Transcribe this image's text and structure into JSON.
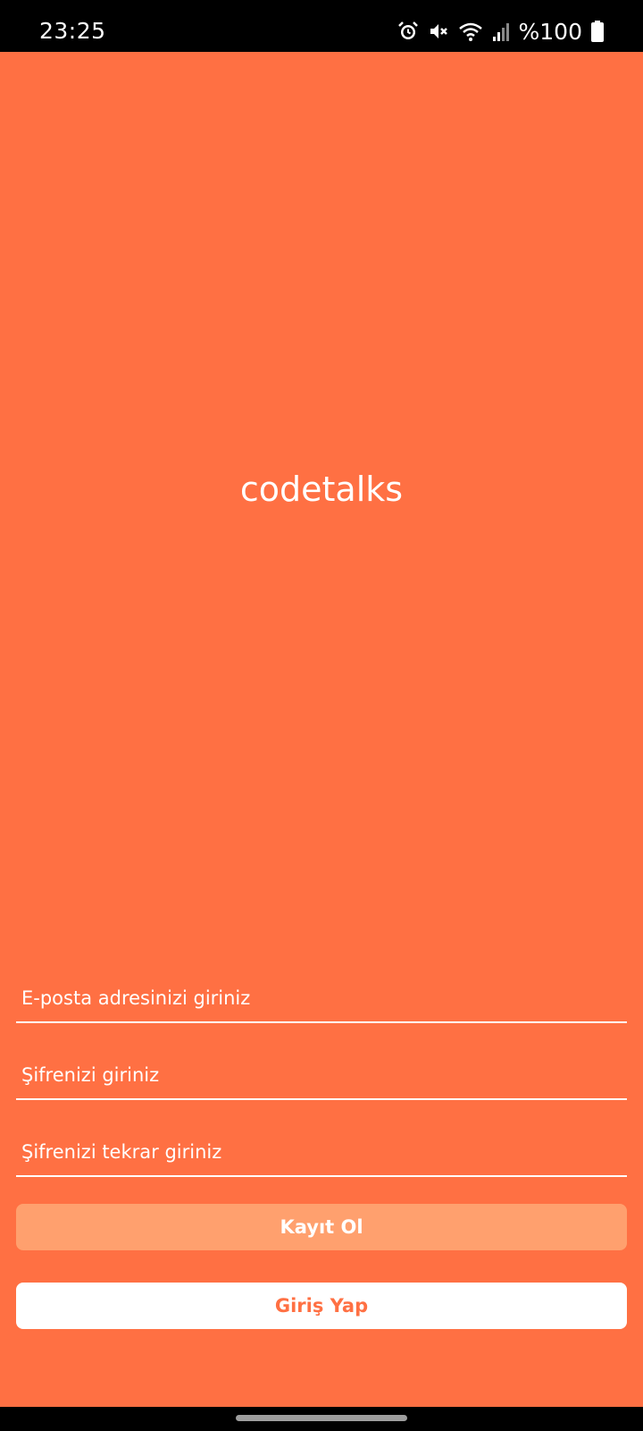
{
  "status_bar": {
    "time": "23:25",
    "battery_percent": "%100",
    "icons": [
      "alarm-icon",
      "mute-icon",
      "wifi-icon",
      "signal-icon",
      "battery-icon"
    ]
  },
  "app": {
    "title": "codetalks"
  },
  "form": {
    "email_placeholder": "E-posta adresinizi giriniz",
    "password_placeholder": "Şifrenizi giriniz",
    "password_confirm_placeholder": "Şifrenizi tekrar giriniz",
    "register_label": "Kayıt Ol",
    "login_label": "Giriş Yap"
  },
  "colors": {
    "background": "#ff7043",
    "register_button": "#ffa06e",
    "login_button": "#ffffff",
    "login_text": "#ff7043"
  }
}
